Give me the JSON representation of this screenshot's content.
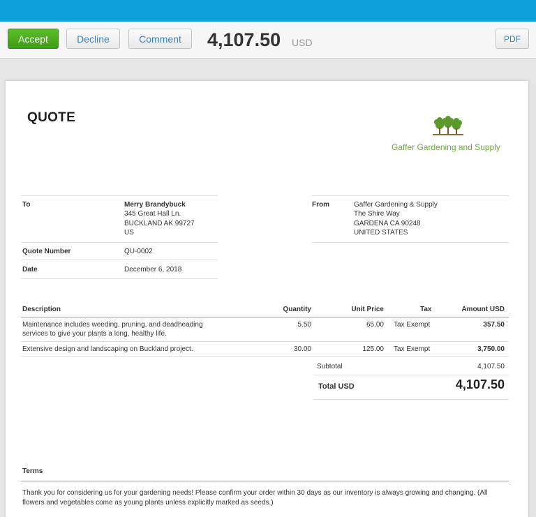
{
  "toolbar": {
    "accept_label": "Accept",
    "decline_label": "Decline",
    "comment_label": "Comment",
    "total_amount": "4,107.50",
    "currency": "USD",
    "pdf_label": "PDF"
  },
  "colors": {
    "topbar": "#0d9fd8",
    "accept": "#4caf20",
    "logo_green": "#6aa83a"
  },
  "quote": {
    "title": "QUOTE",
    "logo_icon": "trees-icon",
    "logo_text": "Gaffer Gardening and Supply",
    "to_label": "To",
    "to_name": "Merry Brandybuck",
    "to_address": [
      "345 Great Hall Ln.",
      "BUCKLAND AK 99727",
      "US"
    ],
    "quote_number_label": "Quote Number",
    "quote_number": "QU-0002",
    "date_label": "Date",
    "date": "December 6, 2018",
    "from_label": "From",
    "from_address": [
      "Gaffer Gardening & Supply",
      "The Shire Way",
      "GARDENA CA 90248",
      "UNITED STATES"
    ]
  },
  "items": {
    "headers": {
      "description": "Description",
      "quantity": "Quantity",
      "unit_price": "Unit Price",
      "tax": "Tax",
      "amount": "Amount USD"
    },
    "rows": [
      {
        "description": [
          "Maintenance includes weeding, pruning, and deadheading",
          "services to give your plants a long, healthy life."
        ],
        "quantity": "5.50",
        "unit_price": "65.00",
        "tax": "Tax Exempt",
        "amount": "357.50"
      },
      {
        "description": [
          "Extensive design and landscaping on Buckland project."
        ],
        "quantity": "30.00",
        "unit_price": "125.00",
        "tax": "Tax Exempt",
        "amount": "3,750.00"
      }
    ],
    "subtotal_label": "Subtotal",
    "subtotal": "4,107.50",
    "total_label": "Total USD",
    "total": "4,107.50"
  },
  "terms": {
    "label": "Terms",
    "text": [
      "Thank you for considering us for your gardening needs! Please confirm your order within 30 days as our inventory is always growing and changing. (All",
      "flowers and vegetables come as young plants unless explicitly marked as seeds.)"
    ]
  }
}
